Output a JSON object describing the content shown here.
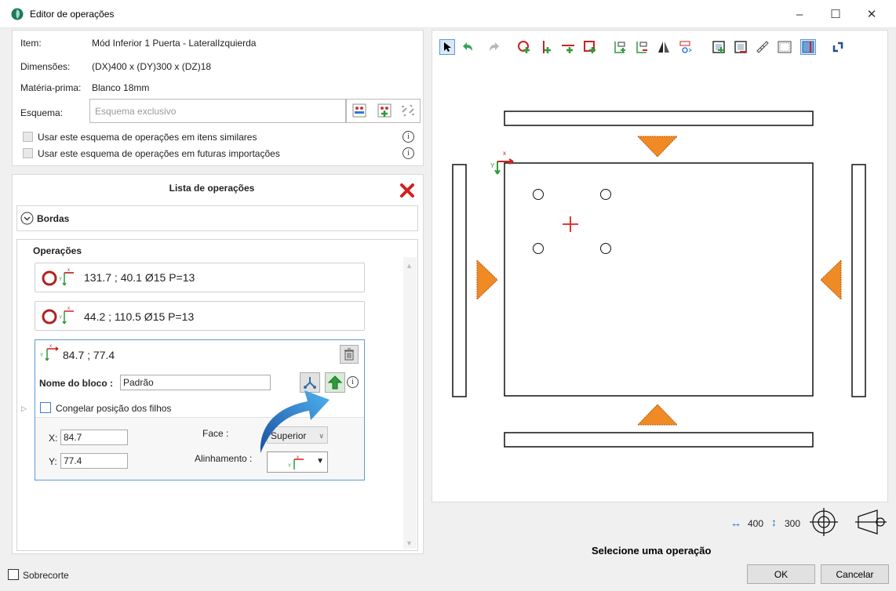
{
  "window": {
    "title": "Editor de operações"
  },
  "item": {
    "item_label": "Item:",
    "item_value": "Mód Inferior 1 Puerta  - LateralIzquierda",
    "dim_label": "Dimensões:",
    "dim_value": "(DX)400 x (DY)300 x (DZ)18",
    "mat_label": "Matéria-prima:",
    "mat_value": "Blanco 18mm",
    "schema_label": "Esquema:",
    "schema_placeholder": "Esquema exclusivo",
    "opt_similar": "Usar este esquema de operações em itens similares",
    "opt_future": "Usar este esquema de operações em futuras importações"
  },
  "ops": {
    "title": "Lista de operações",
    "bordas": "Bordas",
    "operacoes": "Operações",
    "list": [
      {
        "text": "131.7 ; 40.1 Ø15 P=13"
      },
      {
        "text": "44.2 ; 110.5 Ø15 P=13"
      }
    ],
    "block": {
      "coords": "84.7 ; 77.4",
      "name_label": "Nome do bloco :",
      "name_value": "Padrão",
      "freeze_label": "Congelar posição dos filhos",
      "x_label": "X:",
      "x_value": "84.7",
      "y_label": "Y:",
      "y_value": "77.4",
      "face_label": "Face :",
      "face_value": "Superior",
      "align_label": "Alinhamento :"
    }
  },
  "footer": {
    "sobrecorte": "Sobrecorte",
    "status": "Selecione uma operação",
    "dx": "400",
    "dy": "300",
    "ok": "OK",
    "cancel": "Cancelar"
  },
  "colors": {
    "accent": "#1a73c9",
    "arrow_orange": "#f08a24",
    "hole_red": "#b22222",
    "close_red": "#d21f1f",
    "green": "#2e9b3a"
  }
}
